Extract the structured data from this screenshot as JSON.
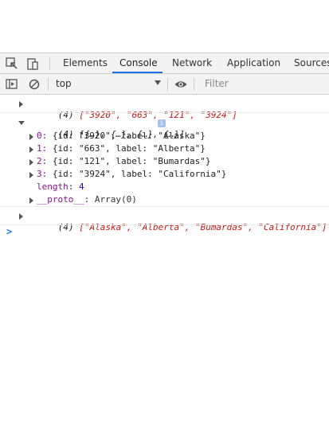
{
  "tabs": [
    "Elements",
    "Console",
    "Network",
    "Application",
    "Sources"
  ],
  "toolbar": {
    "context": "top",
    "filter_placeholder": "Filter"
  },
  "logs": {
    "l1_count": "(4)",
    "l1_arr": "[\"3920\", \"663\", \"121\", \"3924\"]",
    "l2_count": "(4)",
    "l2_arr": "[{…}, {…}, {…}, {…}]",
    "items": [
      {
        "idx": "0:",
        "body": "{id: \"3920\", label: \"Alaska\"}"
      },
      {
        "idx": "1:",
        "body": "{id: \"663\", label: \"Alberta\"}"
      },
      {
        "idx": "2:",
        "body": "{id: \"121\", label: \"Bumardas\"}"
      },
      {
        "idx": "3:",
        "body": "{id: \"3924\", label: \"California\"}"
      }
    ],
    "length_key": "length",
    "length_val": "4",
    "proto_key": "__proto__",
    "proto_val": ": Array(0)",
    "l3_count": "(4)",
    "l3_arr": "[\"Alaska\", \"Alberta\", \"Bumardas\", \"California\"]"
  },
  "prompt_symbol": ">"
}
